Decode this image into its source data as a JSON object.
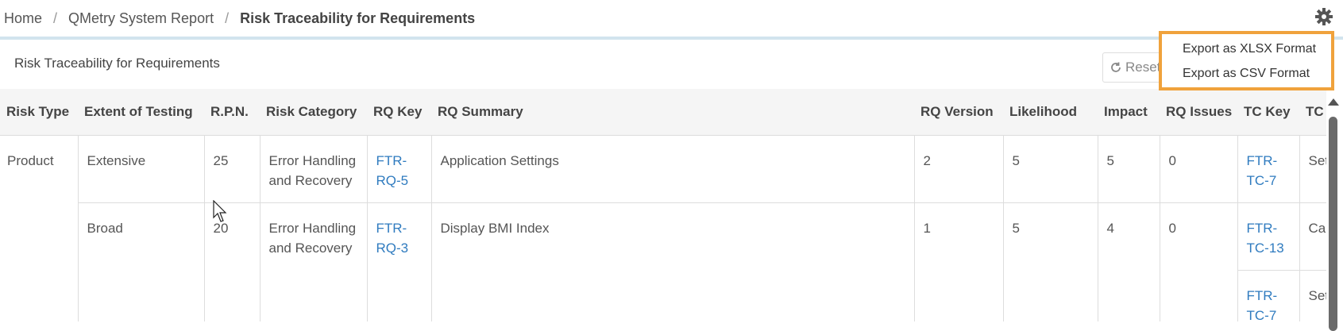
{
  "breadcrumb": {
    "home": "Home",
    "report": "QMetry System Report",
    "current": "Risk Traceability for Requirements",
    "separator": "/"
  },
  "panel": {
    "title": "Risk Traceability for Requirements",
    "reset_label": "Reset"
  },
  "export_menu": {
    "xlsx_label": "Export as XLSX Format",
    "csv_label": "Export as CSV Format"
  },
  "table": {
    "columns": [
      "Risk Type",
      "Extent of Testing",
      "R.P.N.",
      "Risk Category",
      "RQ Key",
      "RQ Summary",
      "RQ Version",
      "Likelihood",
      "Impact",
      "RQ Issues",
      "TC Key",
      "TC S"
    ],
    "rows": [
      {
        "risk_type": "Product",
        "extent": "Extensive",
        "rpn": "25",
        "category": "Error Handling and Recovery",
        "rq_key": "FTR-RQ-5",
        "rq_summary": "Application Settings",
        "rq_version": "2",
        "likelihood": "5",
        "impact": "5",
        "rq_issues": "0",
        "tc_key": "FTR-TC-7",
        "tc_summary": "Set"
      },
      {
        "risk_type": "",
        "extent": "Broad",
        "rpn": "20",
        "category": "Error Handling and Recovery",
        "rq_key": "FTR-RQ-3",
        "rq_summary": "Display BMI Index",
        "rq_version": "1",
        "likelihood": "5",
        "impact": "4",
        "rq_issues": "0",
        "tc_key": "FTR-TC-13",
        "tc_summary": "Calc",
        "tc_key_2": "FTR-TC-7",
        "tc_summary_2": "Set"
      }
    ]
  },
  "colors": {
    "accent_border": "#f0a23c",
    "link": "#2f7bbf",
    "header_bg": "#f5f5f5"
  },
  "icons": {
    "settings": "gear-icon",
    "reset": "refresh-icon"
  }
}
